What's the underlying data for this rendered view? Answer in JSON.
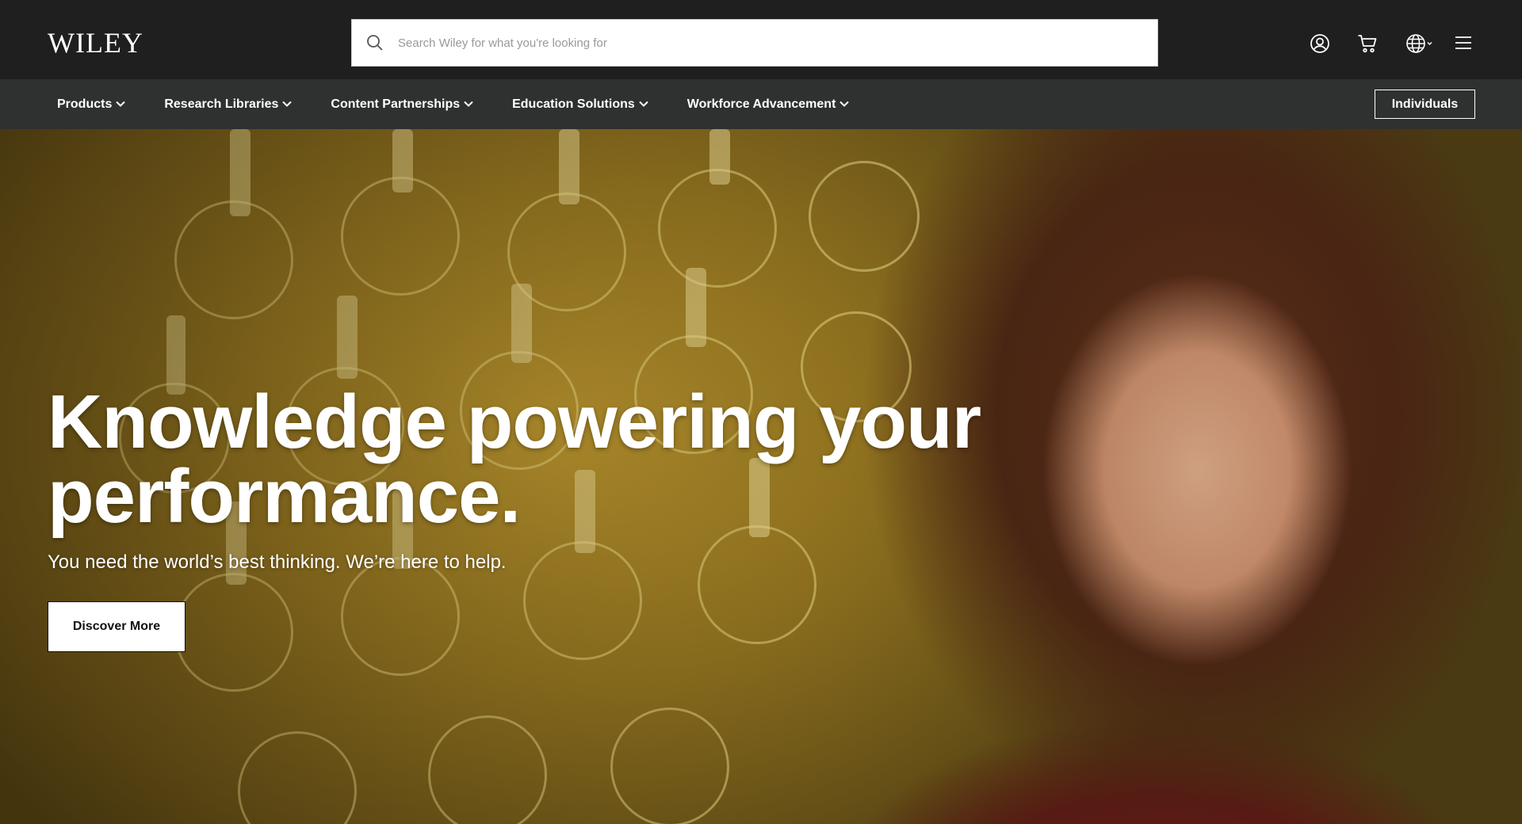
{
  "header": {
    "logo_text": "WILEY",
    "search": {
      "placeholder": "Search Wiley for what you're looking for"
    },
    "icons": [
      "search-icon",
      "account-icon",
      "cart-icon",
      "globe-icon",
      "menu-icon"
    ]
  },
  "nav": {
    "items": [
      {
        "label": "Products"
      },
      {
        "label": "Research Libraries"
      },
      {
        "label": "Content Partnerships"
      },
      {
        "label": "Education Solutions"
      },
      {
        "label": "Workforce Advancement"
      }
    ],
    "individuals_label": "Individuals"
  },
  "hero": {
    "title": "Knowledge powering your performance.",
    "subtitle": "You need the world’s best thinking. We’re here to help.",
    "cta_label": "Discover More"
  },
  "colors": {
    "topbar": "#1f1f1f",
    "navbar": "#2f3030",
    "accent_gold": "#c9a233"
  }
}
